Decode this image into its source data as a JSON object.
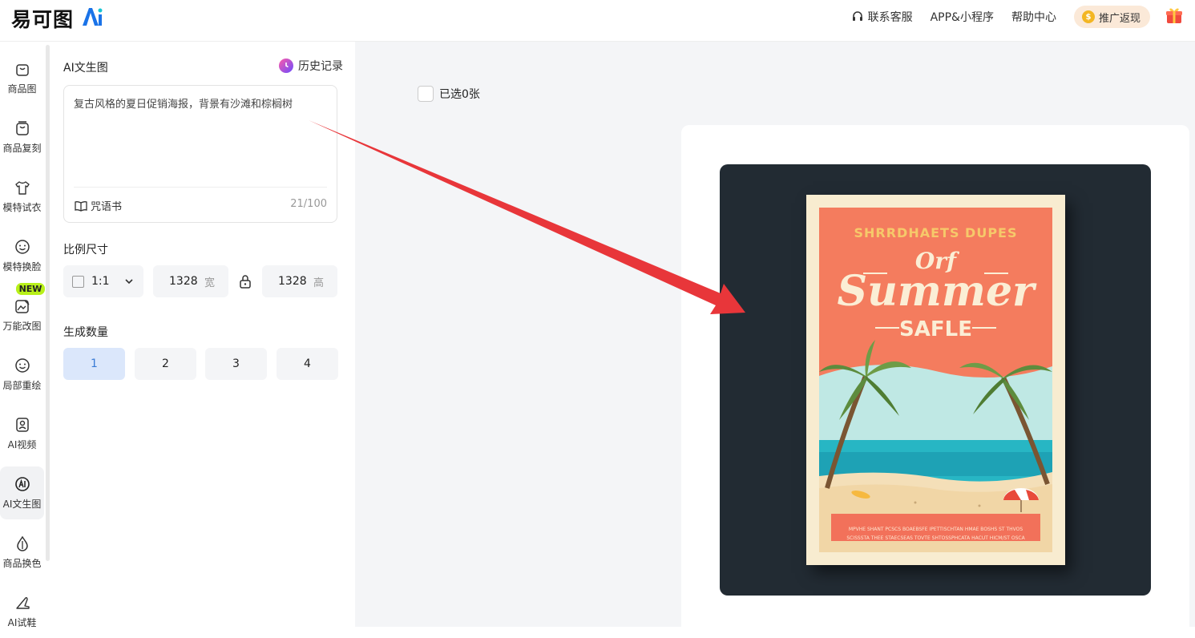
{
  "header": {
    "logo_text": "易可图",
    "logo_ai": "Ai",
    "nav": {
      "contact": "联系客服",
      "app": "APP&小程序",
      "help": "帮助中心",
      "promo": "推广返现"
    }
  },
  "sidebar": {
    "new_badge": "NEW",
    "items": [
      {
        "label": "商品图",
        "icon": "bag-icon"
      },
      {
        "label": "商品复刻",
        "icon": "bag-copy-icon"
      },
      {
        "label": "模特试衣",
        "icon": "shirt-icon"
      },
      {
        "label": "模特换脸",
        "icon": "face-icon"
      },
      {
        "label": "万能改图",
        "icon": "image-edit-icon"
      },
      {
        "label": "局部重绘",
        "icon": "face-redraw-icon"
      },
      {
        "label": "AI视频",
        "icon": "video-icon"
      },
      {
        "label": "AI文生图",
        "icon": "ai-icon",
        "active": true
      },
      {
        "label": "商品换色",
        "icon": "drop-icon"
      },
      {
        "label": "AI试鞋",
        "icon": "shoe-icon"
      }
    ]
  },
  "panel": {
    "title": "AI文生图",
    "history": "历史记录",
    "prompt": "复古风格的夏日促销海报，背景有沙滩和棕榈树",
    "spellbook": "咒语书",
    "char_count": "21/100",
    "ratio_label": "比例尺寸",
    "ratio_value": "1:1",
    "width_value": "1328",
    "width_unit": "宽",
    "height_value": "1328",
    "height_unit": "高",
    "count_label": "生成数量",
    "count_options": [
      "1",
      "2",
      "3",
      "4"
    ],
    "count_selected": "1"
  },
  "canvas": {
    "selected_text": "已选0张",
    "poster": {
      "top_line": "SHRRDHAETS DUPES",
      "of": "Orf",
      "summer": "Summer",
      "safle": "SAFLE",
      "fine_print_1": "MPVHE SHANT PCSCS BOAEBSFE IPETTISCHTAN HMAE BOSHS ST THVOS",
      "fine_print_2": "SCISSSTA THEE STAECSEAS TOVTE SHTOSSPHCATA HACUT HICM/ST OSCA"
    }
  },
  "colors": {
    "accent": "#3a7bd5",
    "new_badge": "#b8f01a",
    "promo_bg": "#fbe9d8",
    "arrow": "#e8363a",
    "poster_bg": "#f47c5e"
  }
}
